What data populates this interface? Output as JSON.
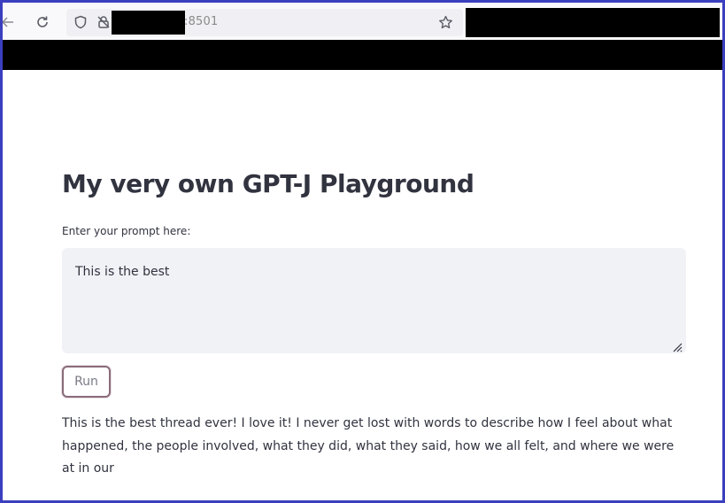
{
  "browser": {
    "url_suffix": ":8501",
    "icons": [
      "back-arrow-icon",
      "reload-icon",
      "shield-icon",
      "lock-icon",
      "star-icon"
    ]
  },
  "app": {
    "title": "My very own GPT-J Playground",
    "prompt_label": "Enter your prompt here:",
    "prompt_value": "This is the best",
    "run_label": "Run",
    "output_text": "This is the best thread ever! I love it! I never get lost with words to describe how I feel about what happened, the people involved, what they did, what they said, how we all felt, and where we were at in our"
  },
  "colors": {
    "frame_border": "#3b3fbf",
    "text": "#31333f",
    "textarea_bg": "#f0f2f6",
    "button_border": "#8a6b7a"
  }
}
